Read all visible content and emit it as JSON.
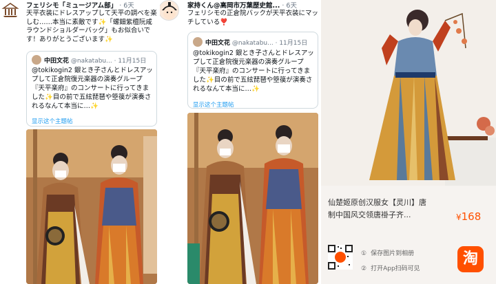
{
  "tweet1": {
    "author": "フェリシモ「ミュージアム部」",
    "time": "6天",
    "text": "天平衣装にドレスアップして天平の調べを楽しむ……本当に素敵です✨「螺鈿紫檀阮咸ラウンドショルダーバッグ」もお似合いです！ありがとうございます✨",
    "quote": {
      "name": "中田文花",
      "handle": "@nakatabu...",
      "date": "11月15日",
      "text": "@tokikogin2 銀とき子さんとドレスアップして正倉院復元楽器の演奏グループ『天平楽府』のコンサートに行ってきました✨目の前で五絃琵琶や箜篌が演奏されるなんて本当に…✨",
      "show_thread": "显示这个主题帖"
    }
  },
  "tweet2": {
    "author": "家持くん@高岡市万葉歴史館...",
    "time": "6天",
    "text": "フェリシモの正倉院バックが天平衣装にマッチしている❣️",
    "quote": {
      "name": "中田文花",
      "handle": "@nakatabu...",
      "date": "11月15日",
      "text": "@tokikogin2 銀とき子さんとドレスアップして正倉院復元楽器の演奏グループ『天平楽府』のコンサートに行ってきました✨目の前で五絃琵琶や箜篌が演奏されるなんて本当に…✨",
      "show_thread": "显示这个主题帖"
    }
  },
  "shop": {
    "title": "仙楚姬原创汉服女【灵川】唐制中国风交领唐褂子齐...",
    "currency": "¥",
    "price": "168",
    "option1": "保存图片到相册",
    "option2": "打开App扫码可见",
    "option1_num": "①",
    "option2_num": "②",
    "app_icon": "淘"
  },
  "colors": {
    "link": "#1d9bf0",
    "price": "#ff5000",
    "taobao": "#ff5000",
    "text": "#0f1419",
    "muted": "#6b7785"
  }
}
